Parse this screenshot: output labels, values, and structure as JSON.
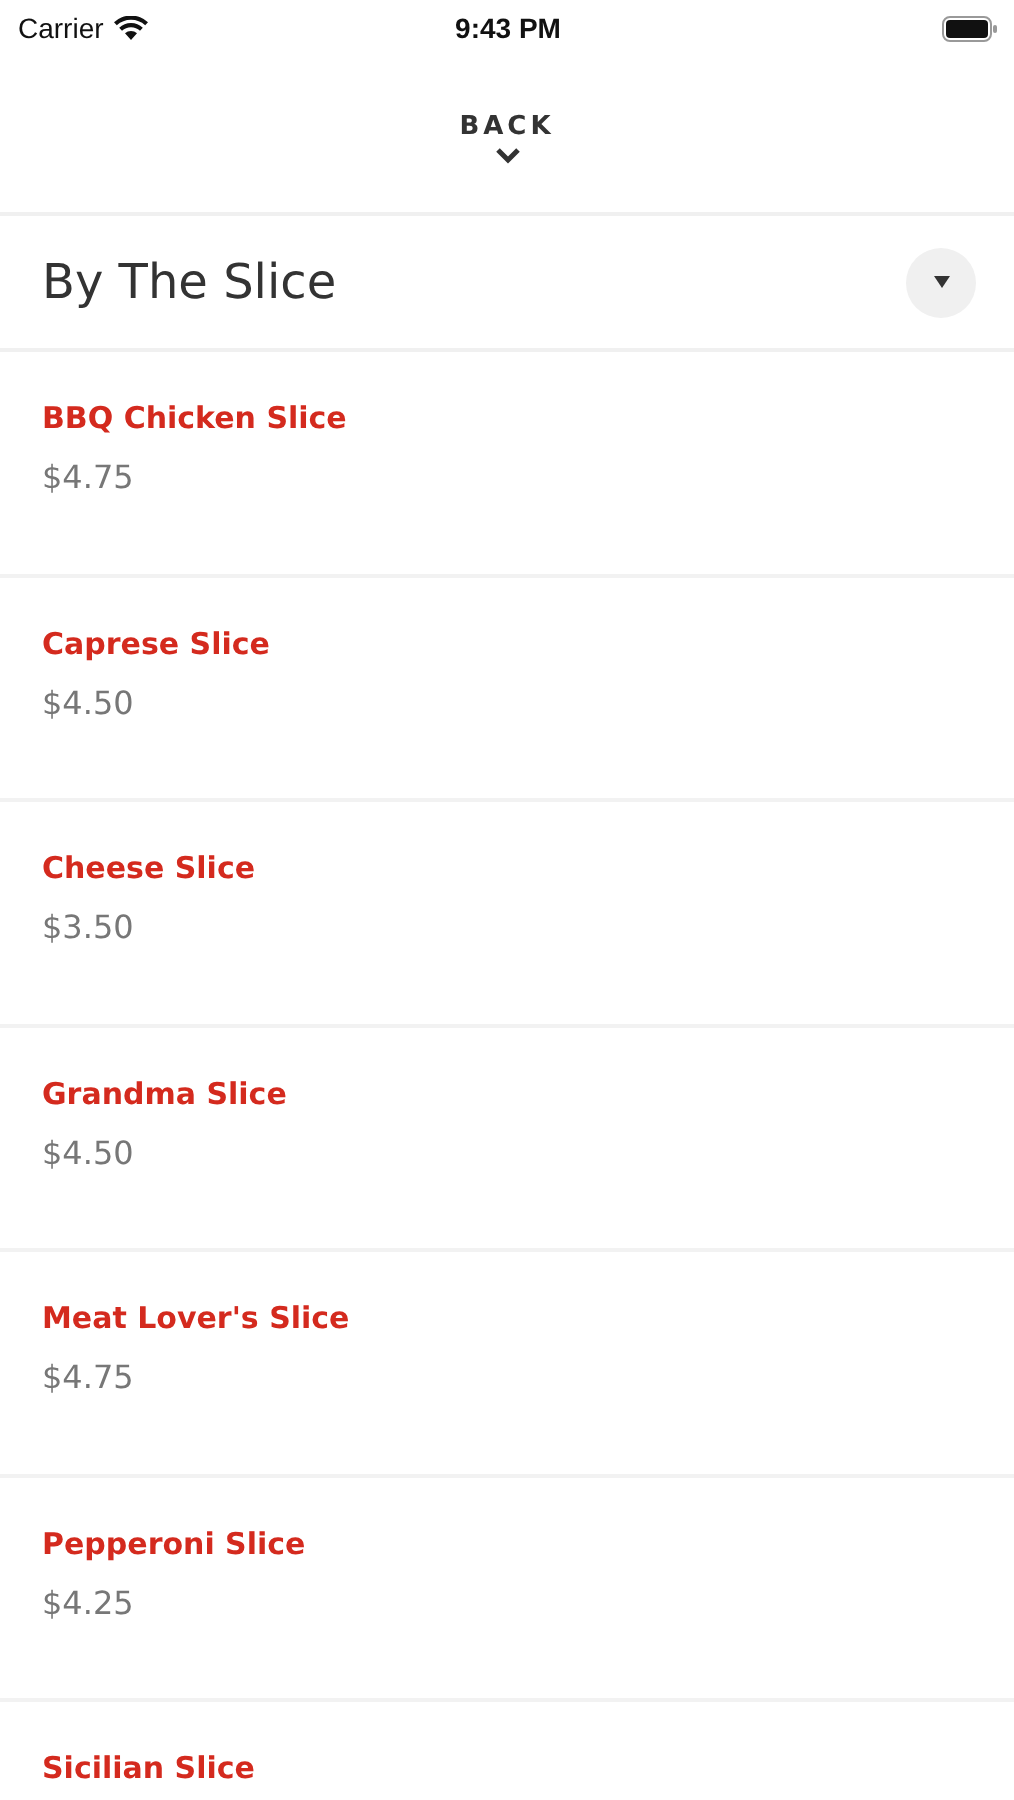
{
  "status_bar": {
    "carrier": "Carrier",
    "time": "9:43 PM"
  },
  "back": {
    "label": "BACK"
  },
  "section": {
    "title": "By The Slice",
    "expanded": true
  },
  "items": [
    {
      "name": "BBQ Chicken Slice",
      "price": "$4.75"
    },
    {
      "name": "Caprese Slice",
      "price": "$4.50"
    },
    {
      "name": "Cheese Slice",
      "price": "$3.50"
    },
    {
      "name": "Grandma Slice",
      "price": "$4.50"
    },
    {
      "name": "Meat Lover's Slice",
      "price": "$4.75"
    },
    {
      "name": "Pepperoni Slice",
      "price": "$4.25"
    },
    {
      "name": "Sicilian Slice"
    }
  ]
}
